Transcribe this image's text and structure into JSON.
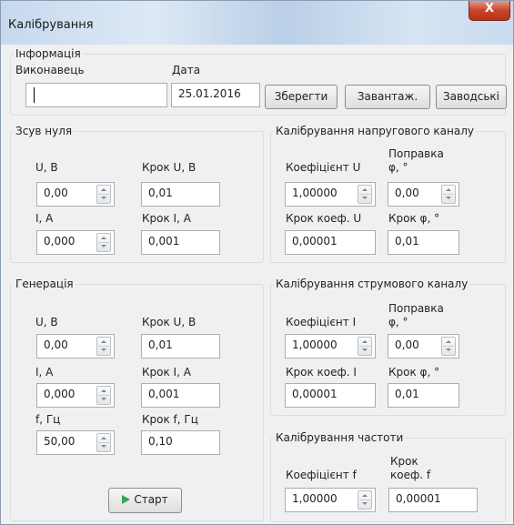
{
  "window": {
    "title": "Калібрування",
    "close_label": "X"
  },
  "info": {
    "legend": "Інформація",
    "performer_label": "Виконавець",
    "performer_value": "",
    "date_label": "Дата",
    "date_value": "25.01.2016",
    "save_button": "Зберегти",
    "load_button": "Завантаж.",
    "factory_button": "Заводські"
  },
  "zero_shift": {
    "legend": "Зсув нуля",
    "u_label": "U, В",
    "u_value": "0,00",
    "u_step_label": "Крок U, В",
    "u_step_value": "0,01",
    "i_label": "I, А",
    "i_value": "0,000",
    "i_step_label": "Крок I, А",
    "i_step_value": "0,001"
  },
  "voltage_cal": {
    "legend": "Калібрування напругового каналу",
    "coef_label": "Коефіцієнт U",
    "coef_value": "1,00000",
    "phase_label_1": "Поправка",
    "phase_label_2": "φ, °",
    "phase_value": "0,00",
    "coef_step_label": "Крок коеф. U",
    "coef_step_value": "0,00001",
    "phase_step_label": "Крок φ, °",
    "phase_step_value": "0,01"
  },
  "generation": {
    "legend": "Генерація",
    "u_label": "U, В",
    "u_value": "0,00",
    "u_step_label": "Крок U, В",
    "u_step_value": "0,01",
    "i_label": "I, А",
    "i_value": "0,000",
    "i_step_label": "Крок I, А",
    "i_step_value": "0,001",
    "f_label": "f, Гц",
    "f_value": "50,00",
    "f_step_label": "Крок f, Гц",
    "f_step_value": "0,10",
    "start_button": "Старт"
  },
  "current_cal": {
    "legend": "Калібрування струмового каналу",
    "coef_label": "Коефіцієнт I",
    "coef_value": "1,00000",
    "phase_label_1": "Поправка",
    "phase_label_2": "φ, °",
    "phase_value": "0,00",
    "coef_step_label": "Крок коеф. I",
    "coef_step_value": "0,00001",
    "phase_step_label": "Крок φ, °",
    "phase_step_value": "0,01"
  },
  "frequency_cal": {
    "legend": "Калібрування частоти",
    "coef_label": "Коефіцієнт f",
    "coef_value": "1,00000",
    "step_label_1": "Крок",
    "step_label_2": "коеф. f",
    "step_value": "0,00001"
  },
  "icons": {
    "close": "close-icon",
    "spin": "spinner-arrows-icon",
    "start": "play-icon"
  },
  "colors": {
    "close_button": "#c7452b",
    "start_icon": "#34a853",
    "titlebar": "#c7d9ee"
  }
}
